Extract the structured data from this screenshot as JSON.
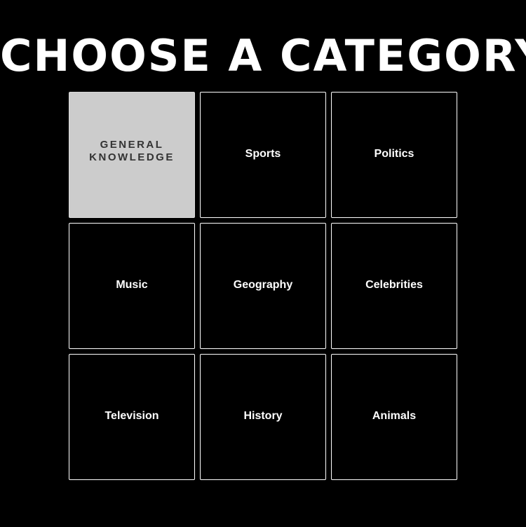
{
  "header": {
    "title": "CHOOSE A CATEGORY"
  },
  "categories": [
    {
      "label": "General Knowledge",
      "selected": true
    },
    {
      "label": "Sports",
      "selected": false
    },
    {
      "label": "Politics",
      "selected": false
    },
    {
      "label": "Music",
      "selected": false
    },
    {
      "label": "Geography",
      "selected": false
    },
    {
      "label": "Celebrities",
      "selected": false
    },
    {
      "label": "Television",
      "selected": false
    },
    {
      "label": "History",
      "selected": false
    },
    {
      "label": "Animals",
      "selected": false
    }
  ],
  "colors": {
    "background": "#000000",
    "text": "#ffffff",
    "tile_border": "#ffffff",
    "selected_tile_bg": "#cccccc",
    "selected_tile_text": "#333333"
  }
}
